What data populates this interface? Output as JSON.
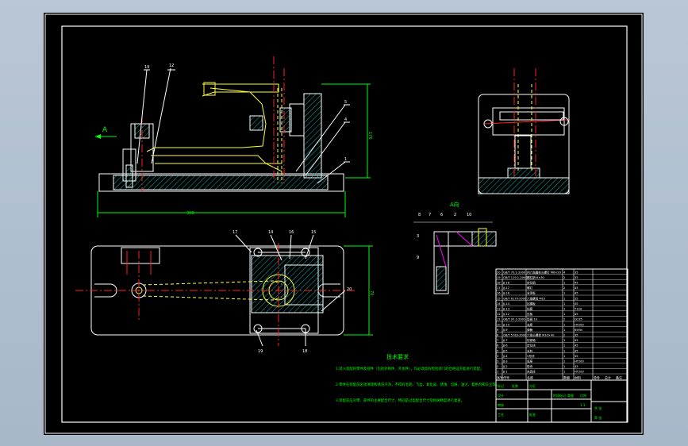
{
  "view_label": "A",
  "view_label_alt": "A向",
  "tech_title": "技术要求",
  "tech_lines": [
    "1.装入装配的零件及部件（包括外购件、外协件），均必须具有检验部门的合格证方能进行装配。",
    "2.零件在装配前必须清理和清洗干净，不得有毛刺、飞边、氧化皮、锈蚀、切屑、油污、着色剂和灰尘等。",
    "3.装配前应对零、部件的主要配合尺寸，特别是过盈配合尺寸及相关精度进行复查。"
  ],
  "balloons_front": [
    "19",
    "12",
    "5",
    "4",
    "1"
  ],
  "balloons_top": [
    "17",
    "14",
    "16",
    "15",
    "20",
    "19",
    "18"
  ],
  "balloons_side": [
    "8",
    "7",
    "6",
    "2",
    "10",
    "3",
    "9"
  ],
  "dim_length": "390",
  "dim_height": "176",
  "dim_width": "70",
  "bom_header": [
    "序号",
    "代号",
    "名称",
    "数量",
    "材料",
    "单件",
    "总计",
    "备注"
  ],
  "bom_rows": [
    [
      "20",
      "GB/T 70.1-2000",
      "内六角圆柱头螺钉 M6×20",
      "4",
      "35",
      ""
    ],
    [
      "19",
      "GB/T 119.1-2000",
      "圆柱销 6×30",
      "2",
      "35",
      ""
    ],
    [
      "18",
      "JJ-18",
      "定位销",
      "1",
      "45",
      ""
    ],
    [
      "17",
      "JJ-17",
      "螺钉",
      "2",
      "45",
      ""
    ],
    [
      "16",
      "JJ-16",
      "支承板",
      "1",
      "45",
      ""
    ],
    [
      "15",
      "GB/T 6170-2000",
      "六角螺母 M10",
      "1",
      "35",
      ""
    ],
    [
      "14",
      "JJ-14",
      "钻模板",
      "1",
      "45",
      ""
    ],
    [
      "13",
      "JJ-13",
      "钻套",
      "1",
      "T10A",
      ""
    ],
    [
      "12",
      "JJ-12",
      "压板",
      "1",
      "45",
      ""
    ],
    [
      "11",
      "GB/T 97.1-2002",
      "垫圈 10",
      "2",
      "Q235",
      ""
    ],
    [
      "10",
      "JJ-10",
      "支座",
      "1",
      "HT200",
      ""
    ],
    [
      "9",
      "JJ-9",
      "弹簧",
      "1",
      "65Mn",
      ""
    ],
    [
      "8",
      "GB/T 5783-2000",
      "六角头螺栓 M10×40",
      "2",
      "35",
      ""
    ],
    [
      "7",
      "JJ-7",
      "铰链轴",
      "1",
      "45",
      ""
    ],
    [
      "6",
      "JJ-6",
      "定位块",
      "1",
      "45",
      ""
    ],
    [
      "5",
      "JJ-5",
      "支柱",
      "1",
      "45",
      ""
    ],
    [
      "4",
      "JJ-4",
      "V形块",
      "1",
      "45",
      ""
    ],
    [
      "3",
      "JJ-3",
      "底座",
      "1",
      "HT200",
      ""
    ],
    [
      "2",
      "JJ-2",
      "垫块",
      "1",
      "45",
      ""
    ],
    [
      "1",
      "JJ-1",
      "夹具体",
      "1",
      "HT200",
      ""
    ]
  ],
  "title_block": [
    "标记",
    "处数",
    "分区",
    "设计",
    "审核",
    "工艺",
    "批准",
    "阶段标记",
    "重量",
    "比例",
    "1:1",
    "共 张",
    "第 张"
  ],
  "colors": {
    "frame": "#ffffff",
    "outline": "#ffffff",
    "dimension": "#00ff00",
    "centerline": "#ff2020",
    "hidden": "#ffff40",
    "hatch": "#00b0b0",
    "highlight": "#ff00ff"
  }
}
